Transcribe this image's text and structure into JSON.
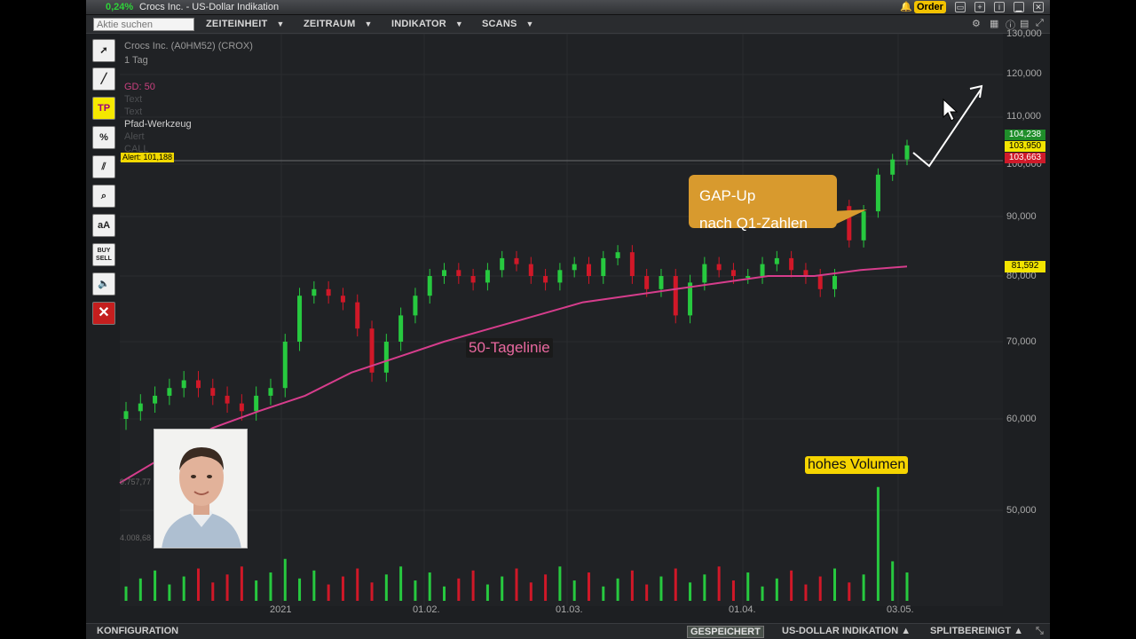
{
  "titlebar": {
    "change_pct": "0,24%",
    "title": "Crocs Inc. - US-Dollar Indikation",
    "order_label": "Order"
  },
  "toolbar": {
    "search_placeholder": "Aktie suchen",
    "menus": [
      "ZEITEINHEIT",
      "ZEITRAUM",
      "INDIKATOR",
      "SCANS"
    ]
  },
  "tools": {
    "tp_label": "TP",
    "percent_label": "%",
    "text_size_label": "aA",
    "buy_sell_label_1": "BUY",
    "buy_sell_label_2": "SELL",
    "close_label": "✕"
  },
  "chart_info": {
    "instrument": "Crocs Inc. (A0HM52) (CROX)",
    "timeframe": "1 Tag",
    "go_label": "GD: 50",
    "text1": "Text",
    "text2": "Text",
    "pfad": "Pfad-Werkzeug",
    "alert_faint": "Alert",
    "call_faint": "CALL",
    "alert_tag": "Alert: 101,188"
  },
  "annotations": {
    "gap_line1": "GAP-Up",
    "gap_line2": "nach Q1-Zahlen",
    "ma_label": "50-Tagelinie",
    "volume_label": "hohes Volumen"
  },
  "price_axis": {
    "labels": [
      "130,000",
      "120,000",
      "110,000",
      "100,000",
      "90,000",
      "80,000",
      "70,000",
      "60,000",
      "50,000"
    ],
    "tag_high": "104,238",
    "tag_mid": "103,950",
    "tag_low": "103,663",
    "tag_ma": "81,592"
  },
  "volume_axis": {
    "label_a": "9.757,77",
    "label_b": "4.008,68"
  },
  "x_axis": [
    "2021",
    "01.02.",
    "01.03.",
    "01.04.",
    "03.05."
  ],
  "status": {
    "config": "KONFIGURATION",
    "saved": "GESPEICHERT",
    "usd": "US-DOLLAR INDIKATION ▲",
    "split": "SPLITBEREINIGT ▲"
  },
  "chart_data": {
    "type": "candlestick",
    "title": "Crocs Inc. (A0HM52) (CROX)",
    "timeframe": "1 Tag",
    "indicator": "GD: 50",
    "x_ticks": [
      "2021",
      "01.02.",
      "01.03.",
      "01.04.",
      "03.05."
    ],
    "y_ticks": [
      50,
      60,
      70,
      80,
      90,
      100,
      110,
      120,
      130
    ],
    "ylim": [
      45,
      132
    ],
    "close_approx": [
      61,
      62,
      63,
      64,
      65,
      64,
      63,
      62,
      61,
      63,
      64,
      70,
      77,
      78,
      77,
      76,
      72,
      66,
      70,
      74,
      77,
      80,
      81,
      80,
      79,
      81,
      83,
      82,
      80,
      79,
      81,
      82,
      80,
      83,
      84,
      80,
      78,
      80,
      74,
      79,
      82,
      81,
      80,
      80,
      82,
      83,
      81,
      80,
      78,
      80,
      86,
      91,
      98,
      101,
      104
    ],
    "ma50_approx": [
      53,
      56,
      59,
      61,
      63,
      66,
      68,
      70,
      72,
      74,
      76,
      77,
      78,
      79,
      80,
      80,
      81,
      81.6
    ],
    "colors": {
      "up": "#27c93f",
      "down": "#d01828",
      "ma": "#d63d8c"
    }
  }
}
